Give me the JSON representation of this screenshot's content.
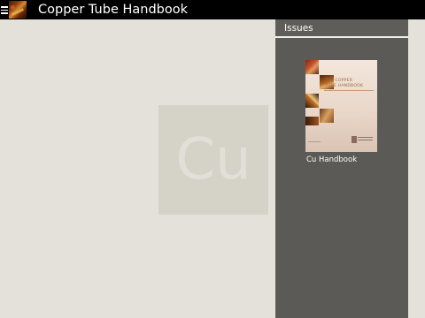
{
  "app": {
    "title": "Copper Tube Handbook"
  },
  "watermark": {
    "text": "Cu"
  },
  "issues": {
    "header": "Issues",
    "items": [
      {
        "label": "Cu Handbook",
        "cover_title_line1": "THE COPPER",
        "cover_title_line2": "TUBE HANDBOOK"
      }
    ]
  },
  "colors": {
    "topbar": "#000000",
    "background": "#e4e1da",
    "watermark_box": "#d5d2c8",
    "panel": "#5b5a56",
    "copper_accent": "#c07028"
  },
  "icons": {
    "menu": "hamburger-menu-icon",
    "app": "copper-app-icon"
  }
}
